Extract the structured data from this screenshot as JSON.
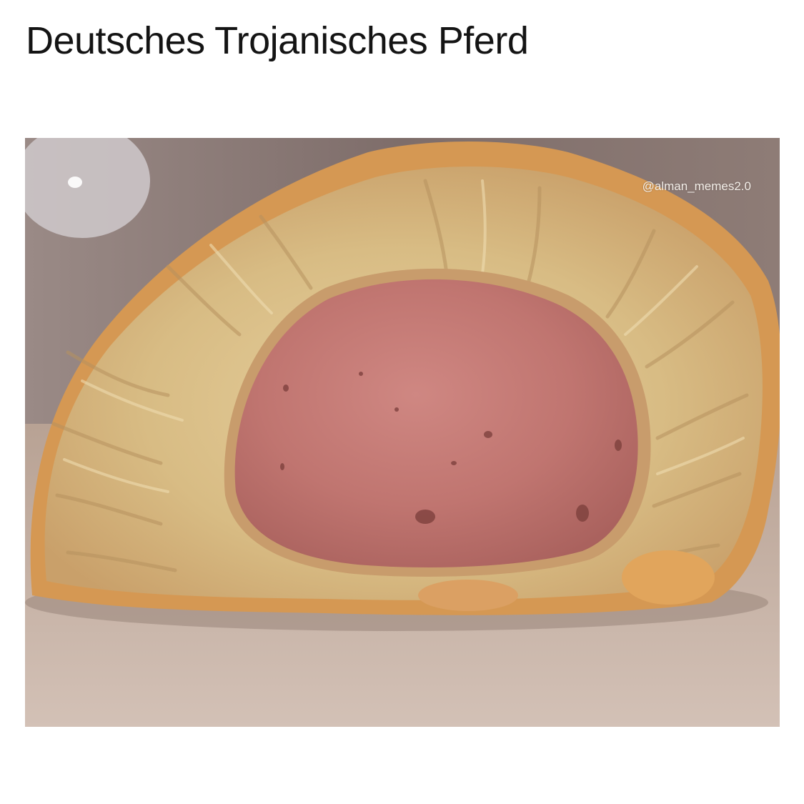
{
  "post": {
    "caption": "Deutsches Trojanisches Pferd",
    "watermark": "@alman_memes2.0"
  },
  "photo": {
    "subject": "bread-roll-with-sausage-cross-section",
    "colors": {
      "background_wall": "#8f7d78",
      "table": "#c9b3a6",
      "crust": "#d79a54",
      "crumb": "#d9bd86",
      "sausage": "#c27a75"
    }
  }
}
